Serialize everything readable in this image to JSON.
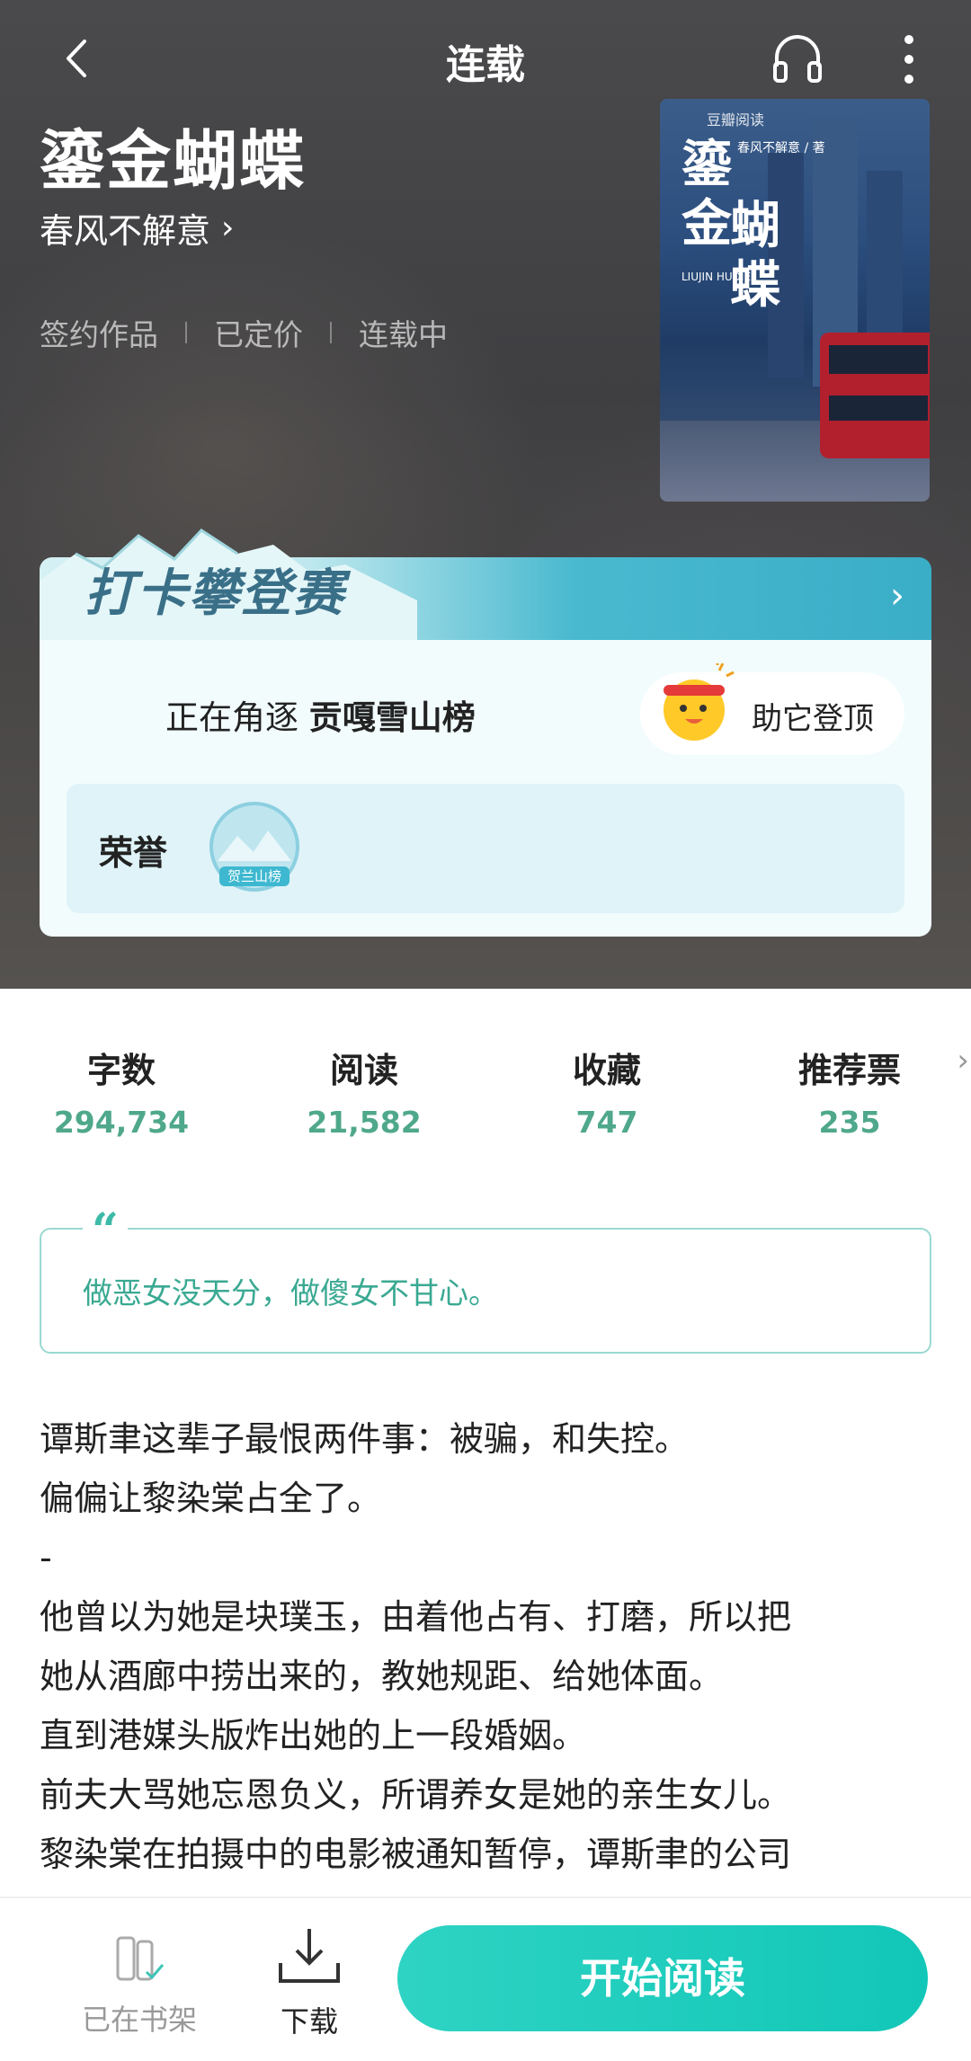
{
  "header": {
    "title": "连载"
  },
  "book": {
    "title": "鎏金蝴蝶",
    "author": "春风不解意",
    "tags": [
      "签约作品",
      "已定价",
      "连载中"
    ]
  },
  "cover": {
    "brand": "豆瓣阅读",
    "title_col1": "鎏金",
    "title_col2": "蝴蝶",
    "pinyin": "LIUJIN HUDIE",
    "author_line": "春风不解意 / 著"
  },
  "campaign": {
    "logo": "打卡攀登赛",
    "rank_prefix": "正在角逐",
    "rank_name": "贡嘎雪山榜",
    "help_label": "助它登顶",
    "honor_label": "荣誉",
    "badge_text": "贺兰山榜"
  },
  "stats": [
    {
      "label": "字数",
      "value": "294,734"
    },
    {
      "label": "阅读",
      "value": "21,582"
    },
    {
      "label": "收藏",
      "value": "747"
    },
    {
      "label": "推荐票",
      "value": "235"
    }
  ],
  "quote": {
    "mark": "66",
    "text": "做恶女没天分，做傻女不甘心。"
  },
  "intro": {
    "lines": [
      "谭斯聿这辈子最恨两件事：被骗，和失控。",
      "偏偏让黎染棠占全了。",
      "-",
      "他曾以为她是块璞玉，由着他占有、打磨，所以把",
      "她从酒廊中捞出来的，教她规距、给她体面。",
      "直到港媒头版炸出她的上一段婚姻。",
      "前夫大骂她忘恩负义，所谓养女是她的亲生女儿。",
      "黎染棠在拍摄中的电影被通知暂停，谭斯聿的公司"
    ]
  },
  "bottom": {
    "shelf_label": "已在书架",
    "download_label": "下载",
    "read_label": "开始阅读"
  },
  "colors": {
    "accent": "#14c8b9",
    "stat_value": "#4fa88b",
    "quote_text": "#3aa992"
  },
  "icons": [
    "back-icon",
    "headphones-icon",
    "more-vertical-icon",
    "chevron-right-icon",
    "bookshelf-icon",
    "download-icon"
  ]
}
